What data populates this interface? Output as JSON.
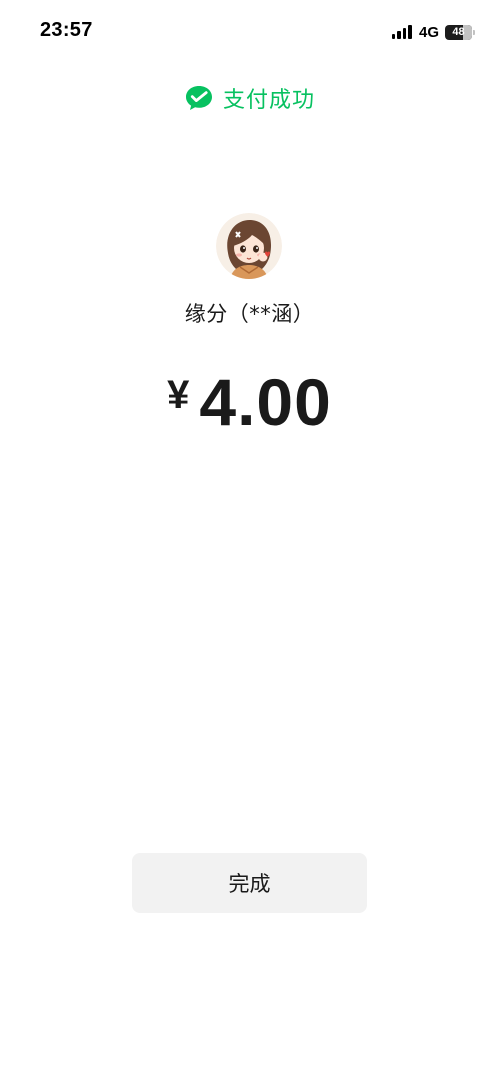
{
  "status_bar": {
    "time": "23:57",
    "network": "4G",
    "battery": "48",
    "icons": [
      "signal-icon",
      "battery-icon"
    ]
  },
  "header": {
    "title": "支付成功",
    "icon": "wechat-pay-check-icon",
    "accent_color": "#07c160"
  },
  "payee": {
    "avatar": "cartoon-girl-avatar",
    "name": "缘分（**涵）"
  },
  "payment": {
    "currency_symbol": "¥",
    "amount": "4.00"
  },
  "actions": {
    "done_label": "完成"
  }
}
